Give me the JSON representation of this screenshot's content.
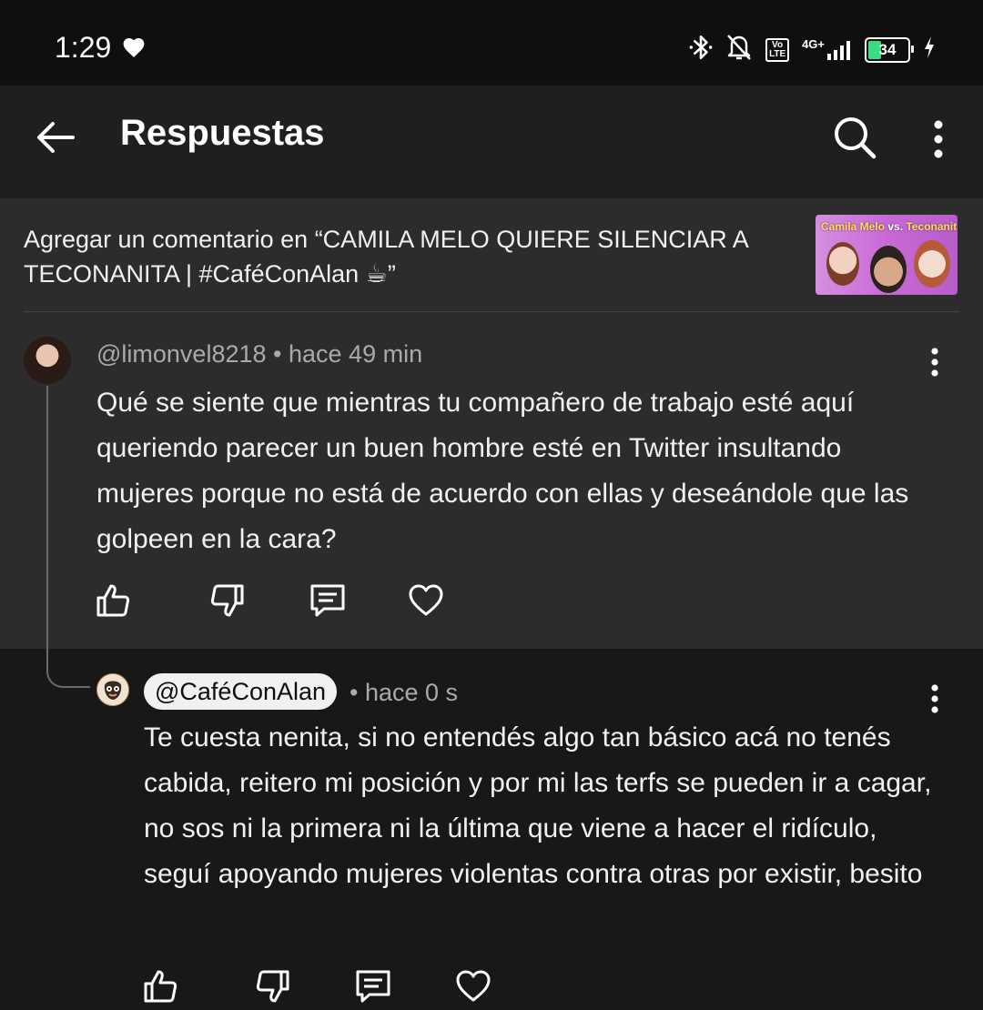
{
  "status_bar": {
    "time": "1:29",
    "battery": "34",
    "network": "4G+",
    "volte": "Vo LTE"
  },
  "header": {
    "title": "Respuestas"
  },
  "context": {
    "add_comment_text": "Agregar un comentario en “CAMILA MELO QUIERE SILENCIAR A TECONANITA | #CaféConAlan ☕”",
    "thumbnail_title_left": "Camila Melo",
    "thumbnail_title_vs": "vs.",
    "thumbnail_title_right": "Teconanita"
  },
  "comments": [
    {
      "handle": "@limonvel8218",
      "time": "hace 49 min",
      "text": "Qué se siente que mientras tu compañero de trabajo esté aquí queriendo parecer un buen hombre esté en Twitter insultando mujeres porque no está de acuerdo con ellas y deseándole que las golpeen en la cara?"
    },
    {
      "handle": "@CaféConAlan",
      "time": "hace 0 s",
      "text": "Te cuesta nenita, si no entendés algo tan básico acá no tenés cabida, reitero mi posición y por mi las terfs se pueden ir a cagar, no sos ni la primera ni la última que viene a hacer el ridículo, seguí apoyando mujeres violentas contra otras por existir, besito"
    }
  ],
  "colors": {
    "background": "#181818",
    "context_background": "#2c2c2c",
    "app_bar": "#1f1f1f",
    "status_bar": "#0f0f0f",
    "secondary_text": "#aaaaaa"
  },
  "icons": [
    "back-arrow-icon",
    "search-icon",
    "more-vert-icon",
    "like-icon",
    "dislike-icon",
    "reply-icon",
    "heart-icon"
  ]
}
